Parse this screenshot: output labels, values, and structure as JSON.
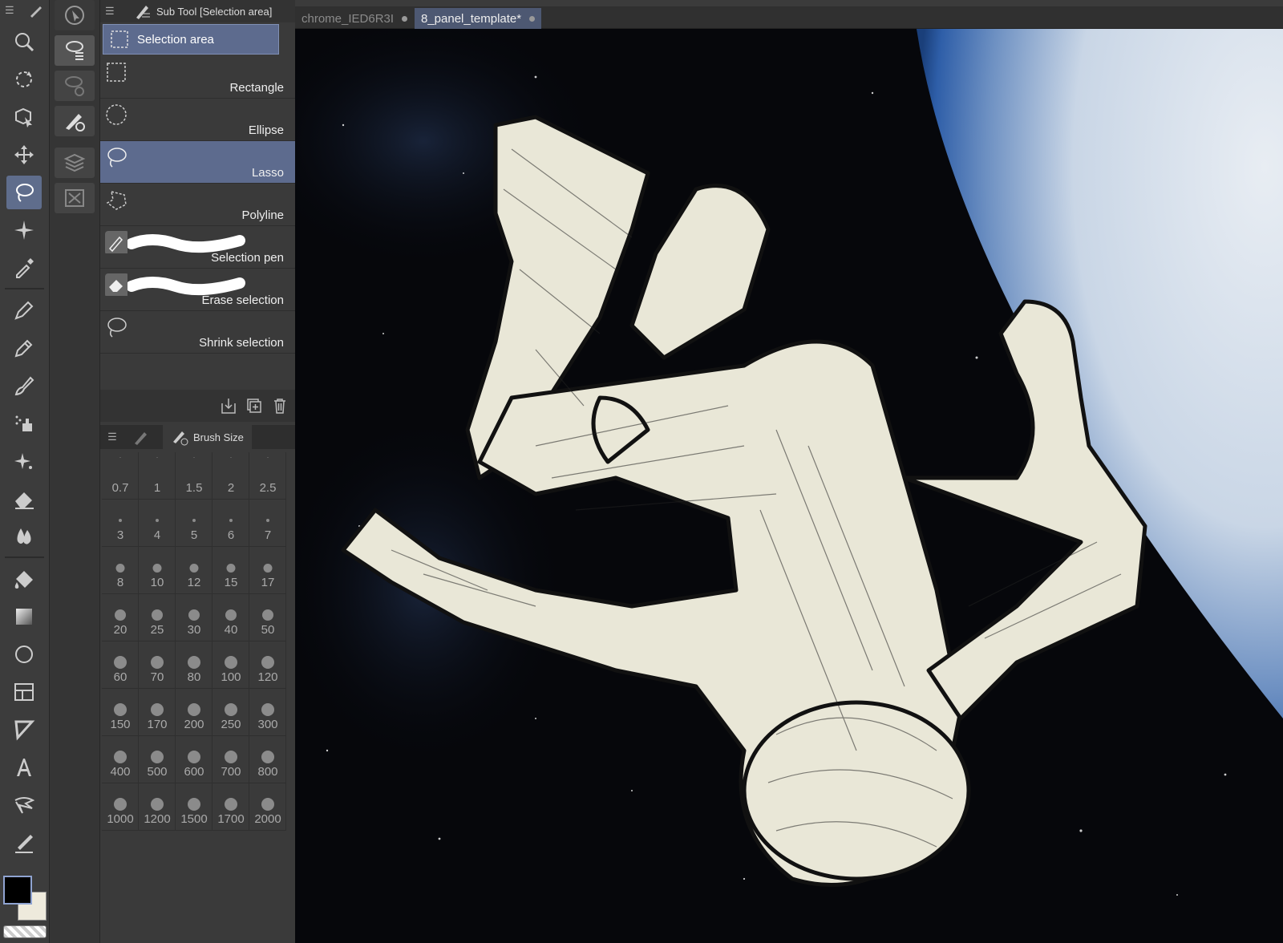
{
  "app": {
    "accent": "#5d6b8e"
  },
  "toolbar": {
    "tools": [
      "zoom-icon",
      "rotate-icon",
      "object-icon",
      "move-icon",
      "lasso-selection-icon",
      "auto-select-icon",
      "eyedropper-icon",
      "pen-icon",
      "pencil-icon",
      "brush-icon",
      "airbrush-icon",
      "decoration-icon",
      "eraser-icon",
      "blend-icon",
      "fill-icon",
      "gradient-icon",
      "figure-icon",
      "frame-border-icon",
      "ruler-icon",
      "text-icon",
      "balloon-icon",
      "correct-line-icon"
    ],
    "active_tool": "lasso-selection-icon",
    "main_color": "#000000",
    "sub_color": "#eeeadc"
  },
  "subtool": {
    "header": "Sub Tool [Selection area]",
    "group_label": "Selection area",
    "items": [
      {
        "label": "Rectangle",
        "icon": "rectangle-selection-icon",
        "active": false
      },
      {
        "label": "Ellipse",
        "icon": "ellipse-selection-icon",
        "active": false
      },
      {
        "label": "Lasso",
        "icon": "lasso-icon",
        "active": true
      },
      {
        "label": "Polyline",
        "icon": "polyline-icon",
        "active": false
      },
      {
        "label": "Selection pen",
        "icon": "selection-pen-icon",
        "active": false
      },
      {
        "label": "Erase selection",
        "icon": "erase-selection-icon",
        "active": false
      },
      {
        "label": "Shrink selection",
        "icon": "shrink-selection-icon",
        "active": false
      }
    ]
  },
  "brush_size": {
    "tab_label": "Brush Size",
    "values": [
      "0.7",
      "1",
      "1.5",
      "2",
      "2.5",
      "3",
      "4",
      "5",
      "6",
      "7",
      "8",
      "10",
      "12",
      "15",
      "17",
      "20",
      "25",
      "30",
      "40",
      "50",
      "60",
      "70",
      "80",
      "100",
      "120",
      "150",
      "170",
      "200",
      "250",
      "300",
      "400",
      "500",
      "600",
      "700",
      "800",
      "1000",
      "1200",
      "1500",
      "1700",
      "2000"
    ]
  },
  "tabs": [
    {
      "label": "chrome_IED6R3I",
      "active": false
    },
    {
      "label": "8_panel_template*",
      "active": true
    }
  ]
}
